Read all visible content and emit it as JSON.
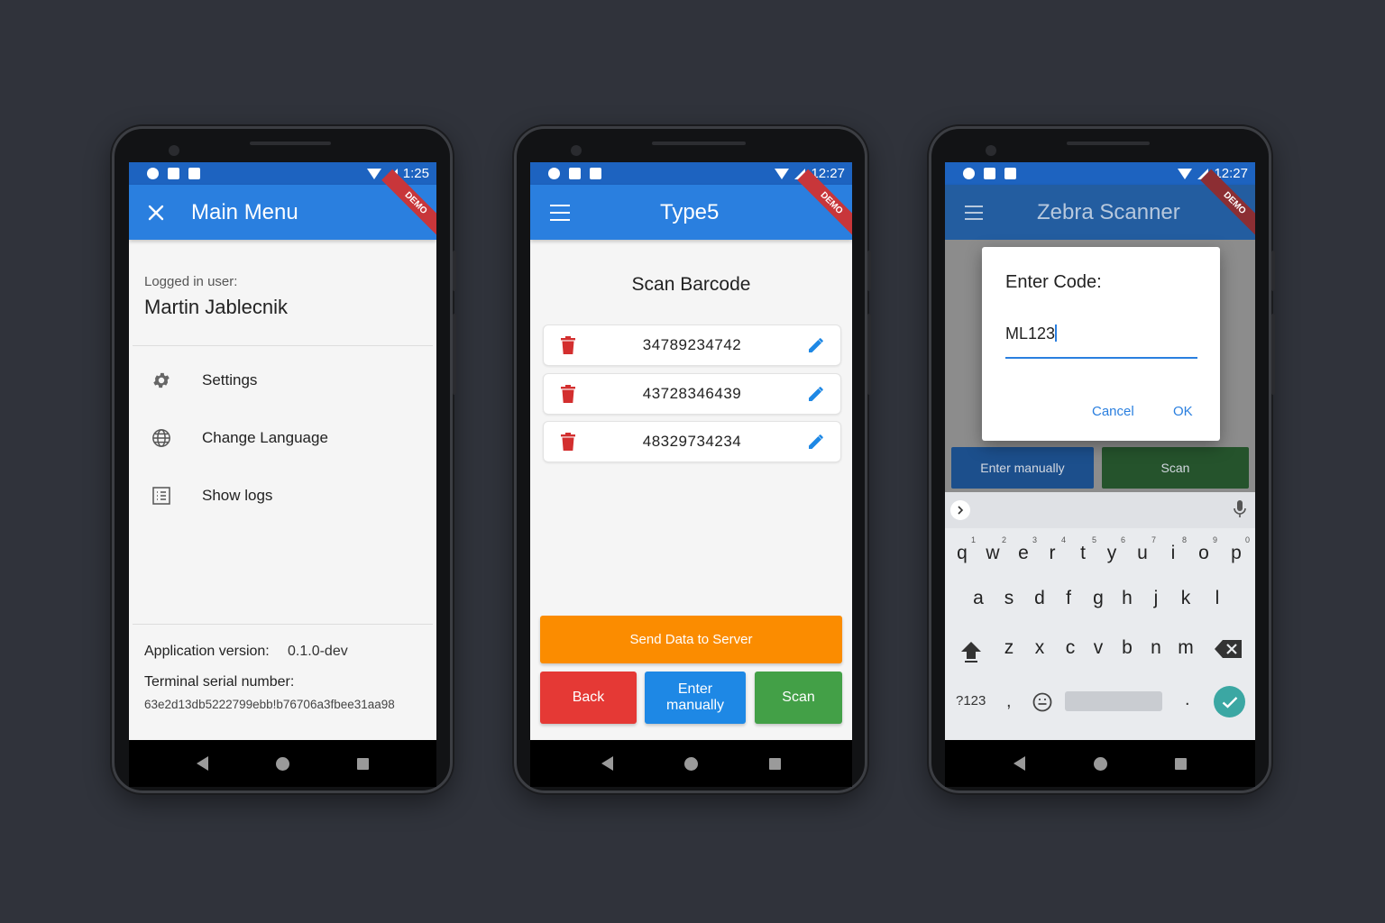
{
  "colors": {
    "background": "#30333b",
    "status_bar": "#1d63c0",
    "app_bar": "#2a7fdf",
    "demo_ribbon": "#c8363a",
    "send_button": "#fb8c00",
    "back_button": "#e53935",
    "enter_manually_button": "#1e88e5",
    "scan_button": "#43a047",
    "delete_icon": "#d32f2f",
    "edit_icon": "#1e88e5",
    "confirm_key": "#3ba7a3"
  },
  "phone1": {
    "status": {
      "time": "1:25"
    },
    "appbar": {
      "title": "Main Menu",
      "demo": "DEMO",
      "leading_icon": "close-icon"
    },
    "logged_in_label": "Logged in user:",
    "user_name": "Martin Jablecnik",
    "menu": [
      {
        "icon": "gear-icon",
        "label": "Settings"
      },
      {
        "icon": "globe-icon",
        "label": "Change Language"
      },
      {
        "icon": "list-icon",
        "label": "Show logs"
      }
    ],
    "app_version_label": "Application version:",
    "app_version": "0.1.0-dev",
    "serial_label": "Terminal serial number:",
    "serial": "63e2d13db5222799ebb!b76706a3fbee31aa98"
  },
  "phone2": {
    "status": {
      "time": "12:27"
    },
    "appbar": {
      "title": "Type5",
      "demo": "DEMO",
      "leading_icon": "menu-icon"
    },
    "section_title": "Scan Barcode",
    "barcodes": [
      "34789234742",
      "43728346439",
      "48329734234"
    ],
    "send_label": "Send Data to Server",
    "back_label": "Back",
    "enter_manually_label": "Enter manually",
    "scan_label": "Scan"
  },
  "phone3": {
    "status": {
      "time": "12:27"
    },
    "appbar": {
      "title": "Zebra Scanner",
      "demo": "DEMO",
      "leading_icon": "menu-icon"
    },
    "dialog": {
      "title": "Enter Code:",
      "value": "ML123",
      "cancel_label": "Cancel",
      "ok_label": "OK"
    },
    "enter_manually_label": "Enter manually",
    "scan_label": "Scan",
    "keyboard": {
      "row1": [
        {
          "k": "q",
          "h": "1"
        },
        {
          "k": "w",
          "h": "2"
        },
        {
          "k": "e",
          "h": "3"
        },
        {
          "k": "r",
          "h": "4"
        },
        {
          "k": "t",
          "h": "5"
        },
        {
          "k": "y",
          "h": "6"
        },
        {
          "k": "u",
          "h": "7"
        },
        {
          "k": "i",
          "h": "8"
        },
        {
          "k": "o",
          "h": "9"
        },
        {
          "k": "p",
          "h": "0"
        }
      ],
      "row2": [
        "a",
        "s",
        "d",
        "f",
        "g",
        "h",
        "j",
        "k",
        "l"
      ],
      "row3": [
        "z",
        "x",
        "c",
        "v",
        "b",
        "n",
        "m"
      ],
      "symbols_key": "?123",
      "comma_key": ",",
      "period_key": "."
    }
  }
}
